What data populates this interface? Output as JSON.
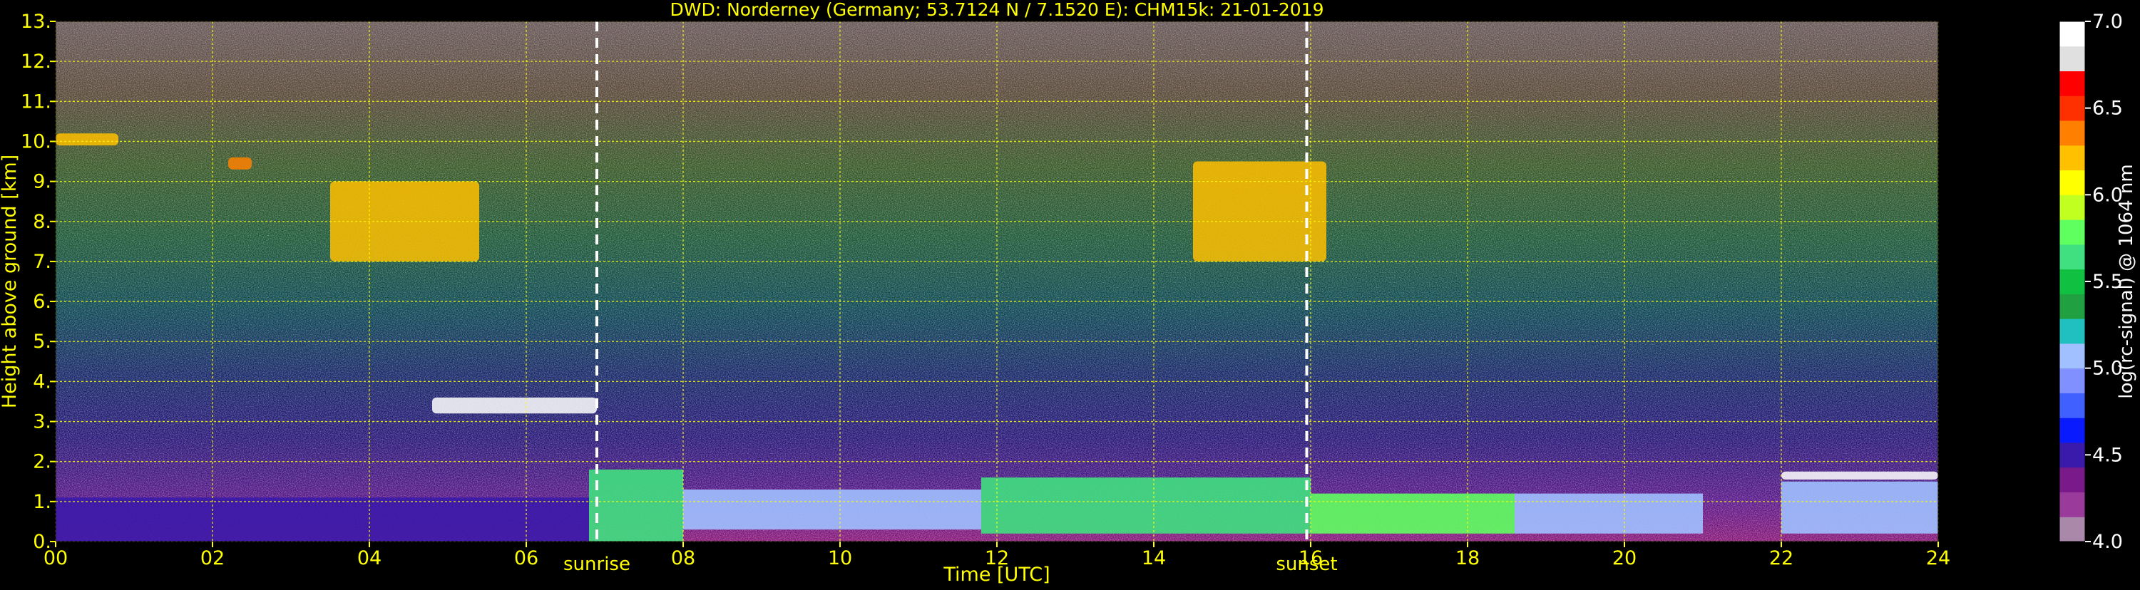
{
  "chart_data": {
    "type": "heatmap",
    "title": "DWD: Norderney (Germany; 53.7124 N / 7.1520 E):    CHM15k: 21-01-2019",
    "xlabel": "Time [UTC]",
    "ylabel": "Height above ground [km]",
    "colorbar_label": "log(rc-signal) @ 1064 nm",
    "xlim": [
      0,
      24
    ],
    "ylim": [
      0,
      13
    ],
    "clim": [
      4.0,
      7.0
    ],
    "x_ticks": [
      0,
      2,
      4,
      6,
      8,
      10,
      12,
      14,
      16,
      18,
      20,
      22,
      24
    ],
    "x_tick_labels": [
      "00",
      "02",
      "04",
      "06",
      "08",
      "10",
      "12",
      "14",
      "16",
      "18",
      "20",
      "22",
      "24"
    ],
    "y_ticks": [
      0,
      1,
      2,
      3,
      4,
      5,
      6,
      7,
      8,
      9,
      10,
      11,
      12,
      13
    ],
    "y_tick_labels": [
      "0.",
      "1.",
      "2.",
      "3.",
      "4.",
      "5.",
      "6.",
      "7.",
      "8.",
      "9.",
      "10.",
      "11.",
      "12.",
      "13."
    ],
    "colorbar_ticks": [
      4.0,
      4.5,
      5.0,
      5.5,
      6.0,
      6.5,
      7.0
    ],
    "colorbar_tick_labels": [
      "4.0",
      "4.5",
      "5.0",
      "5.5",
      "6.0",
      "6.5",
      "7.0"
    ],
    "grid": true,
    "grid_color": "#ffff00",
    "label_color": "#ffff00",
    "background": "#000000",
    "colormap": [
      "#aa88aa",
      "#9a3a9a",
      "#7a1a8a",
      "#3a1aaa",
      "#0a1aff",
      "#4060ff",
      "#8090ff",
      "#a0c0ff",
      "#20c0c0",
      "#20a040",
      "#10c040",
      "#40e080",
      "#60ff60",
      "#c0ff20",
      "#ffff00",
      "#ffc000",
      "#ff8000",
      "#ff3000",
      "#ff0000",
      "#e0e0e0",
      "#ffffff"
    ],
    "markers": [
      {
        "x": 6.9,
        "label": "sunrise"
      },
      {
        "x": 15.95,
        "label": "sunset"
      }
    ],
    "features": [
      {
        "kind": "boundary_layer",
        "x": [
          0,
          6.8
        ],
        "y": [
          0,
          1.1
        ],
        "value": 4.5
      },
      {
        "kind": "boundary_layer",
        "x": [
          6.8,
          8.0
        ],
        "y": [
          0,
          1.8
        ],
        "value": 5.6
      },
      {
        "kind": "boundary_layer",
        "x": [
          8.0,
          11.8
        ],
        "y": [
          0.3,
          1.3
        ],
        "value": 5.1
      },
      {
        "kind": "boundary_layer",
        "x": [
          11.8,
          16.0
        ],
        "y": [
          0.2,
          1.6
        ],
        "value": 5.6
      },
      {
        "kind": "boundary_layer",
        "x": [
          16.0,
          18.6
        ],
        "y": [
          0.2,
          1.2
        ],
        "value": 5.8
      },
      {
        "kind": "boundary_layer",
        "x": [
          18.6,
          21.0
        ],
        "y": [
          0.2,
          1.2
        ],
        "value": 5.0
      },
      {
        "kind": "boundary_layer",
        "x": [
          22.0,
          24.0
        ],
        "y": [
          0.2,
          1.5
        ],
        "value": 5.0
      },
      {
        "kind": "cloud",
        "x": [
          4.8,
          6.9
        ],
        "y": [
          3.2,
          3.6
        ],
        "value": 7.0
      },
      {
        "kind": "cloud",
        "x": [
          22.0,
          24.0
        ],
        "y": [
          1.55,
          1.75
        ],
        "value": 7.0
      },
      {
        "kind": "cloud",
        "x": [
          3.5,
          5.4
        ],
        "y": [
          7.0,
          9.0
        ],
        "value": 6.2
      },
      {
        "kind": "cloud",
        "x": [
          14.5,
          16.2
        ],
        "y": [
          7.0,
          9.5
        ],
        "value": 6.2
      },
      {
        "kind": "cloud",
        "x": [
          0.0,
          0.8
        ],
        "y": [
          9.9,
          10.2
        ],
        "value": 6.2
      },
      {
        "kind": "cloud",
        "x": [
          2.2,
          2.5
        ],
        "y": [
          9.3,
          9.6
        ],
        "value": 6.3
      }
    ]
  }
}
